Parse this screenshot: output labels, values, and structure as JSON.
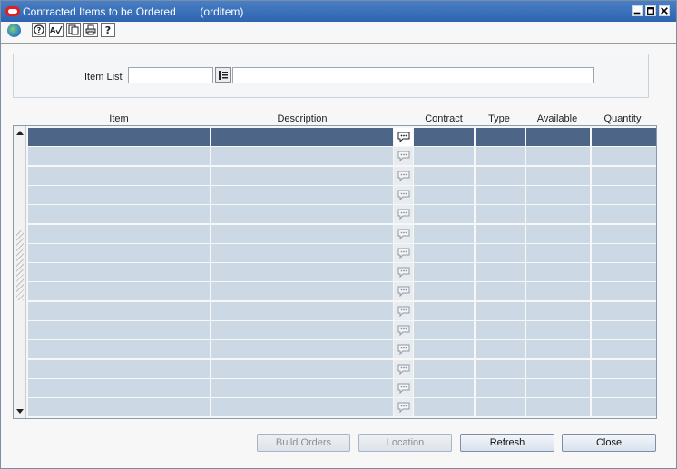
{
  "window": {
    "title": "Contracted Items to be Ordered        (orditem)",
    "icon": "oracle-icon",
    "controls": [
      "minimize-icon",
      "maximize-icon",
      "close-icon"
    ]
  },
  "toolbar": {
    "items": [
      "globe-icon",
      "help-about-icon",
      "spell-check-icon",
      "copy-icon",
      "print-icon",
      "help-icon"
    ]
  },
  "criteria": {
    "item_list_label": "Item List",
    "item_list_value": "",
    "item_list_description": ""
  },
  "grid": {
    "columns": [
      "Item",
      "Description",
      "Contract",
      "Type",
      "Available",
      "Quantity"
    ],
    "row_count": 15,
    "selected_row": 0,
    "rows": []
  },
  "buttons": {
    "build_orders": "Build Orders",
    "location": "Location",
    "refresh": "Refresh",
    "close": "Close"
  },
  "colors": {
    "title_bar": "#2d64b0",
    "selected_row": "#4d6586",
    "row": "#ccd8e4"
  }
}
